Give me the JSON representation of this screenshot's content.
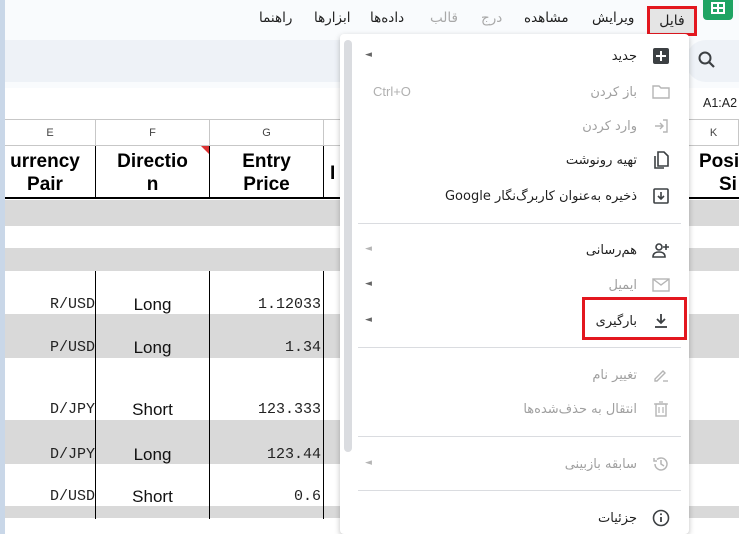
{
  "menubar": {
    "items": [
      {
        "label": "فایل",
        "state": "active"
      },
      {
        "label": "ویرایش",
        "state": "enabled"
      },
      {
        "label": "مشاهده",
        "state": "enabled"
      },
      {
        "label": "درج",
        "state": "disabled"
      },
      {
        "label": "قالب",
        "state": "disabled"
      },
      {
        "label": "داده‌ها",
        "state": "enabled"
      },
      {
        "label": "ابزارها",
        "state": "enabled"
      },
      {
        "label": "راهنما",
        "state": "enabled"
      }
    ]
  },
  "namebox": {
    "value": "A1:A2"
  },
  "sheet": {
    "columns": [
      "E",
      "F",
      "G",
      "",
      "K"
    ],
    "headers": [
      "Currency Pair",
      "Direction",
      "Entry Price",
      "In",
      "Position Size"
    ],
    "header_display": {
      "pair_line1": "urrency",
      "pair_line2": "Pair",
      "dir_line1": "Directio",
      "dir_line2": "n",
      "price_line1": "Entry",
      "price_line2": "Price",
      "partial": "I",
      "pos_line1": "Posi",
      "pos_line2": "Si"
    },
    "rows": [
      {
        "pair": "R/USD",
        "direction": "Long",
        "entry_price": "1.12033"
      },
      {
        "pair": "P/USD",
        "direction": "Long",
        "entry_price": "1.34"
      },
      {
        "pair": "D/JPY",
        "direction": "Short",
        "entry_price": "123.333"
      },
      {
        "pair": "D/JPY",
        "direction": "Long",
        "entry_price": "123.44"
      },
      {
        "pair": "D/USD",
        "direction": "Short",
        "entry_price": "0.6"
      }
    ]
  },
  "file_menu": {
    "items": [
      {
        "label": "جدید",
        "icon": "new-sheet-icon",
        "disabled": false,
        "submenu": true
      },
      {
        "label": "باز کردن",
        "icon": "folder-icon",
        "disabled": true,
        "shortcut": "Ctrl+O"
      },
      {
        "label": "وارد کردن",
        "icon": "import-icon",
        "disabled": true
      },
      {
        "label": "تهیه رونوشت",
        "icon": "copy-icon",
        "disabled": false
      },
      {
        "label": "ذخیره به‌عنوان کاربرگ‌نگار Google",
        "icon": "save-icon",
        "disabled": false
      },
      {
        "label": "هم‌رسانی",
        "icon": "share-icon",
        "disabled": false,
        "submenu": true
      },
      {
        "label": "ایمیل",
        "icon": "mail-icon",
        "disabled": true,
        "submenu": true
      },
      {
        "label": "بارگیری",
        "icon": "download-icon",
        "disabled": false,
        "submenu": true,
        "highlighted": true
      },
      {
        "label": "تغییر نام",
        "icon": "rename-icon",
        "disabled": true
      },
      {
        "label": "انتقال به حذف‌شده‌ها",
        "icon": "trash-icon",
        "disabled": true
      },
      {
        "label": "سابقه بازبینی",
        "icon": "history-icon",
        "disabled": true,
        "submenu": true
      },
      {
        "label": "جزئیات",
        "icon": "info-icon",
        "disabled": false
      }
    ],
    "submenu_arrow": "◄"
  },
  "colors": {
    "highlight": "#e3171f",
    "sheets_green": "#1fa463",
    "band_gray": "#d9d9d9"
  }
}
